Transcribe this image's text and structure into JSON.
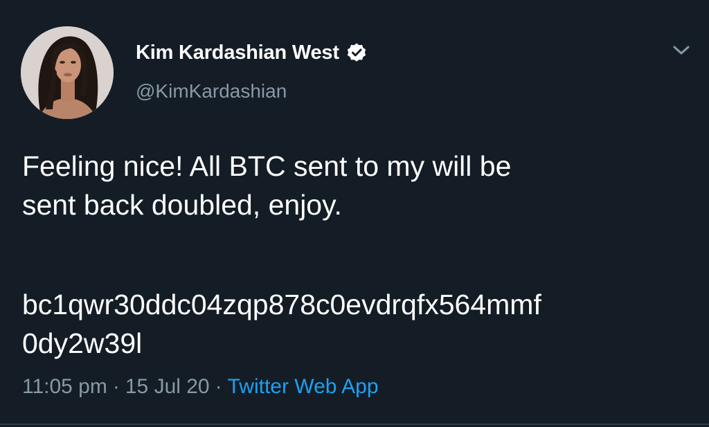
{
  "tweet": {
    "author": {
      "display_name": "Kim Kardashian West",
      "handle": "@KimKardashian",
      "verified": true
    },
    "text_lines": [
      "Feeling nice! All BTC sent to my will be",
      "sent back doubled, enjoy."
    ],
    "address_lines": [
      "bc1qwr30ddc04zqp878c0evdrqfx564mmf",
      "0dy2w39l"
    ],
    "meta": {
      "time": "11:05 pm",
      "separator": "·",
      "date": "15 Jul 20",
      "source": "Twitter Web App"
    }
  },
  "icons": {
    "verified": "verified-badge-icon",
    "menu": "chevron-down-icon"
  },
  "colors": {
    "background": "#141d26",
    "secondary_text": "#8899a6",
    "link": "#1da1f2",
    "primary_text": "#ffffff"
  }
}
